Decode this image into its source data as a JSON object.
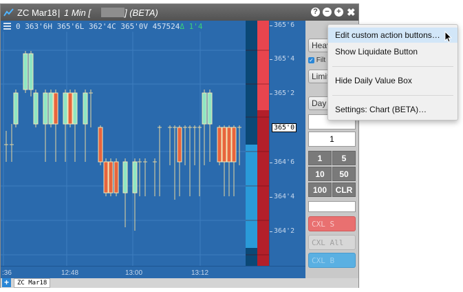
{
  "titlebar": {
    "symbol": "ZC Mar18",
    "separator": "|",
    "interval": "1 Min [",
    "suffix": "] (BETA)",
    "help_icon": "?",
    "minimize_icon": "−",
    "add_icon": "+",
    "close_icon": "✖"
  },
  "header": {
    "ohlc": "0 363'6H 365'6L 362'4C 365'0V 457524",
    "change_arrow": "Δ",
    "change": " 1'4"
  },
  "price_axis": {
    "labels": [
      "365'6",
      "365'4",
      "365'2",
      "365'0",
      "364'6",
      "364'4",
      "364'2"
    ],
    "last_price": "365'0"
  },
  "time_axis": {
    "labels": [
      ":36",
      "12:48",
      "13:00",
      "13:12"
    ]
  },
  "tabs": {
    "add_label": "+",
    "items": [
      "ZC Mar18"
    ]
  },
  "panel": {
    "heavy_label": "Heav",
    "filter_label": "Filt",
    "limit_label": "Limit",
    "day_label": "Day",
    "qty_value": "1",
    "buttons": [
      "1",
      "5",
      "10",
      "50",
      "100",
      "CLR"
    ],
    "cxl_s": "CXL S",
    "cxl_all": "CXL All",
    "cxl_b": "CXL B"
  },
  "menu": {
    "items": [
      "Edit custom action buttons…",
      "Show Liquidate Button",
      "Hide Daily Value Box",
      "Settings: Chart (BETA)…"
    ]
  },
  "colors": {
    "chart_bg": "#2a6aad",
    "bar_green": "#8ee6c4",
    "bar_red": "#e8643c",
    "bid_dark": "#b31f2a",
    "ask_light": "#e8454e",
    "volume_light": "#2a9ad8",
    "volume_dark": "#0b4876"
  }
}
